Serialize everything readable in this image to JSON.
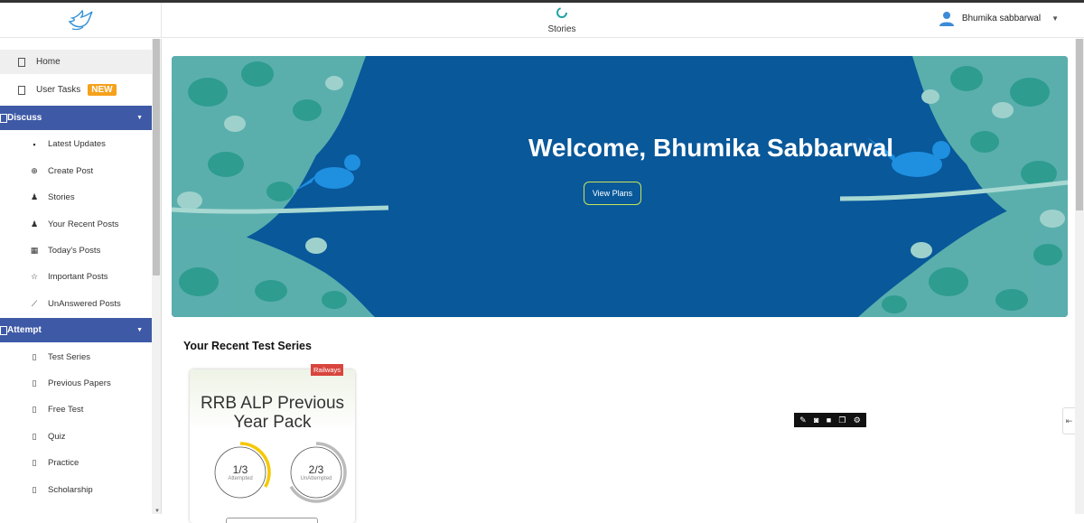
{
  "header": {
    "stories_label": "Stories",
    "user_name": "Bhumika sabbarwal"
  },
  "sidebar": {
    "items": [
      {
        "label": "Home",
        "icon": "page-icon",
        "kind": "top",
        "active": true
      },
      {
        "label": "User Tasks",
        "icon": "page-icon",
        "kind": "top",
        "badge": "NEW"
      },
      {
        "label": "Discuss",
        "icon": "page-icon",
        "kind": "section"
      },
      {
        "label": "Latest Updates",
        "icon": "bell-icon",
        "kind": "sub"
      },
      {
        "label": "Create Post",
        "icon": "plus-circle-icon",
        "kind": "sub"
      },
      {
        "label": "Stories",
        "icon": "users-icon",
        "kind": "sub"
      },
      {
        "label": "Your Recent Posts",
        "icon": "user-clock-icon",
        "kind": "sub"
      },
      {
        "label": "Today's Posts",
        "icon": "calendar-icon",
        "kind": "sub"
      },
      {
        "label": "Important Posts",
        "icon": "star-icon",
        "kind": "sub"
      },
      {
        "label": "UnAnswered Posts",
        "icon": "chart-icon",
        "kind": "sub"
      },
      {
        "label": "Attempt",
        "icon": "page-icon",
        "kind": "section"
      },
      {
        "label": "Test Series",
        "icon": "file-icon",
        "kind": "sub"
      },
      {
        "label": "Previous Papers",
        "icon": "file-icon",
        "kind": "sub"
      },
      {
        "label": "Free Test",
        "icon": "file-icon",
        "kind": "sub"
      },
      {
        "label": "Quiz",
        "icon": "file-icon",
        "kind": "sub"
      },
      {
        "label": "Practice",
        "icon": "file-icon",
        "kind": "sub"
      },
      {
        "label": "Scholarship",
        "icon": "file-icon",
        "kind": "sub"
      }
    ]
  },
  "banner": {
    "welcome": "Welcome, Bhumika Sabbarwal",
    "button_label": "View Plans"
  },
  "recent": {
    "title": "Your Recent Test Series",
    "card": {
      "tag": "Railways",
      "title": "RRB ALP Previous Year Pack",
      "attempted_value": "1/3",
      "attempted_label": "Attempted",
      "attempted_fraction": 0.333,
      "unattempted_value": "2/3",
      "unattempted_label": "UnAttempted",
      "unattempted_fraction": 0.667
    }
  },
  "colors": {
    "section_bg": "#3e5aa6",
    "badge": "#f5a11c",
    "banner_bg": "#08589a",
    "tag": "#d9453e",
    "ring_attempted": "#f5c800",
    "ring_unattempted": "#bbbbbb"
  }
}
